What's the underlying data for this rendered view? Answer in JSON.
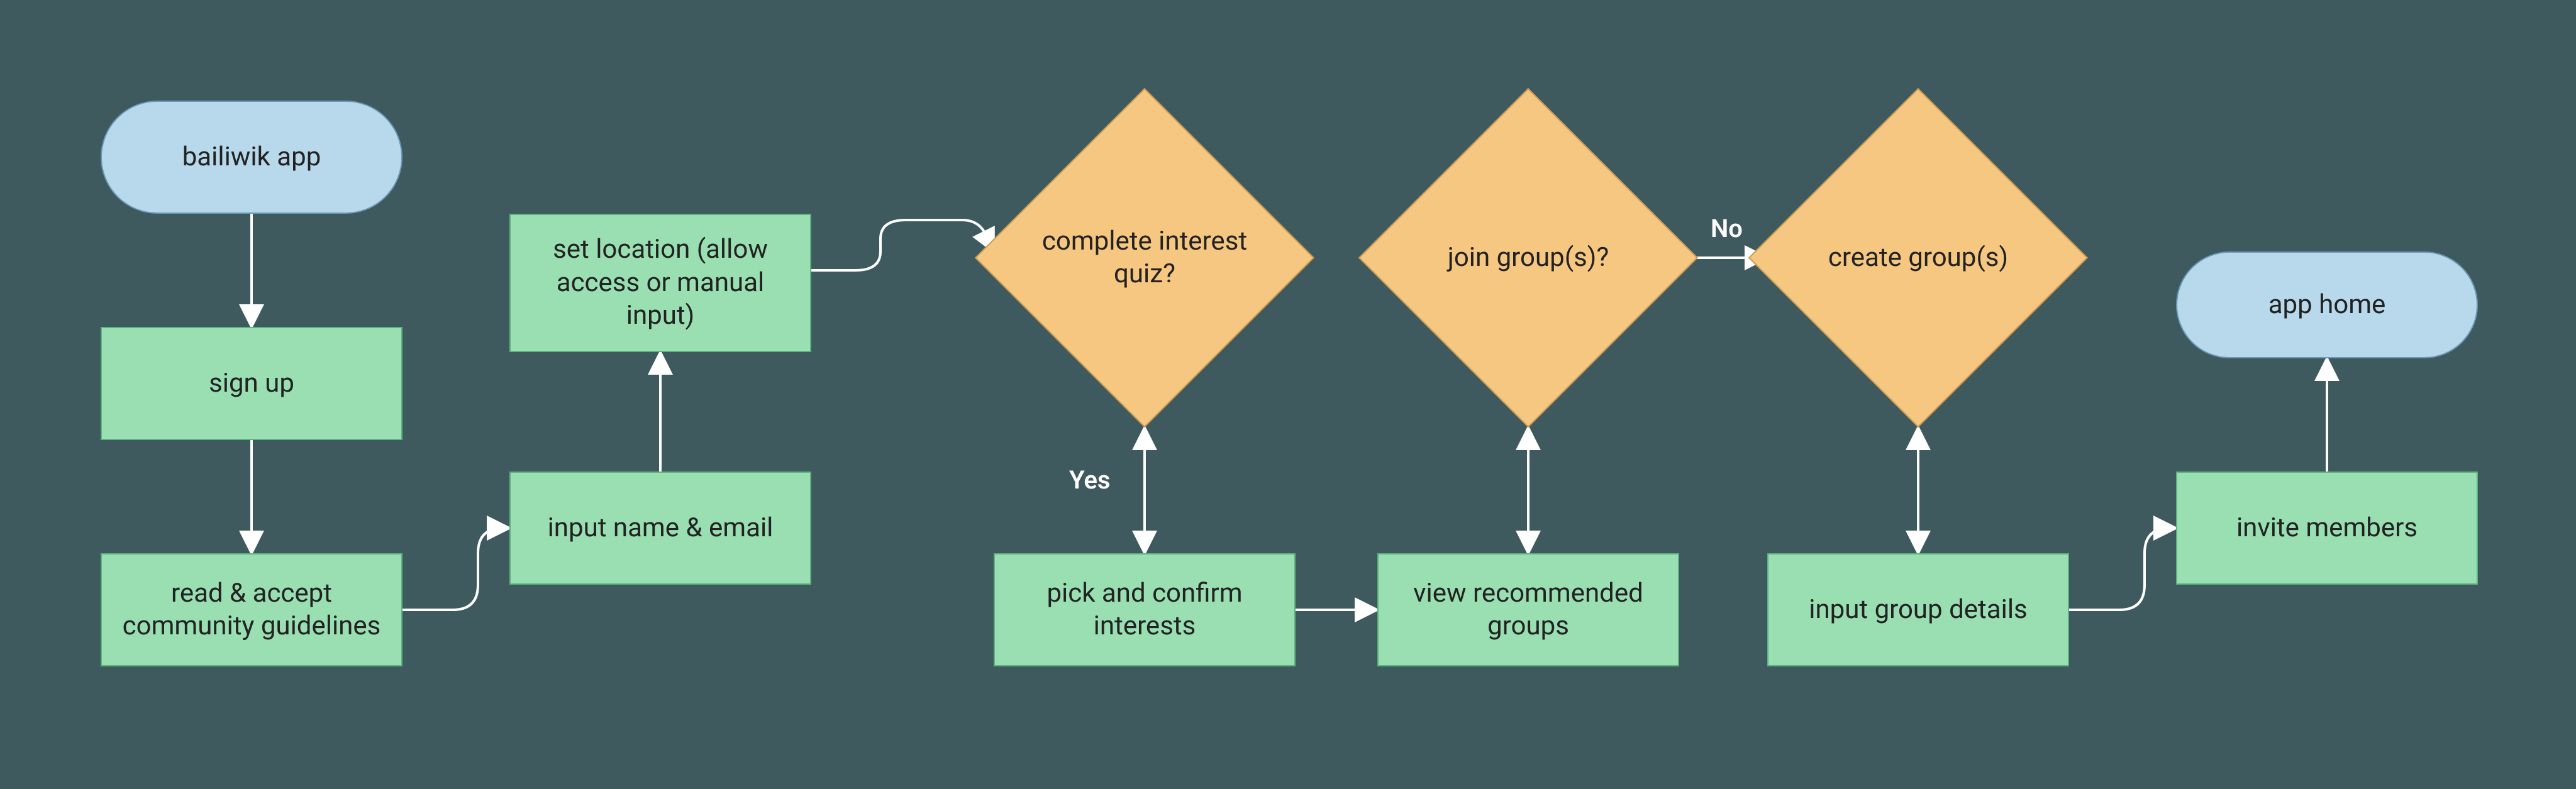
{
  "nodes": {
    "start": "bailiwik app",
    "signup": "sign up",
    "guidelines": "read & accept community guidelines",
    "name_email": "input name & email",
    "location": "set location (allow access or manual input)",
    "quiz": "complete interest quiz?",
    "interests": "pick and confirm interests",
    "view_groups": "view recommended groups",
    "join": "join group(s)?",
    "create": "create group(s)",
    "group_details": "input group details",
    "invite": "invite members",
    "home": "app home"
  },
  "edge_labels": {
    "yes": "Yes",
    "no": "No"
  },
  "colors": {
    "bg": "#3e5a5e",
    "start_fill": "#b8d8eb",
    "start_stroke": "#6a99b6",
    "process_fill": "#99dfb2",
    "process_stroke": "#5cb37e",
    "decision_fill": "#f6c780",
    "decision_stroke": "#cc9a4f",
    "edge": "#ffffff"
  }
}
